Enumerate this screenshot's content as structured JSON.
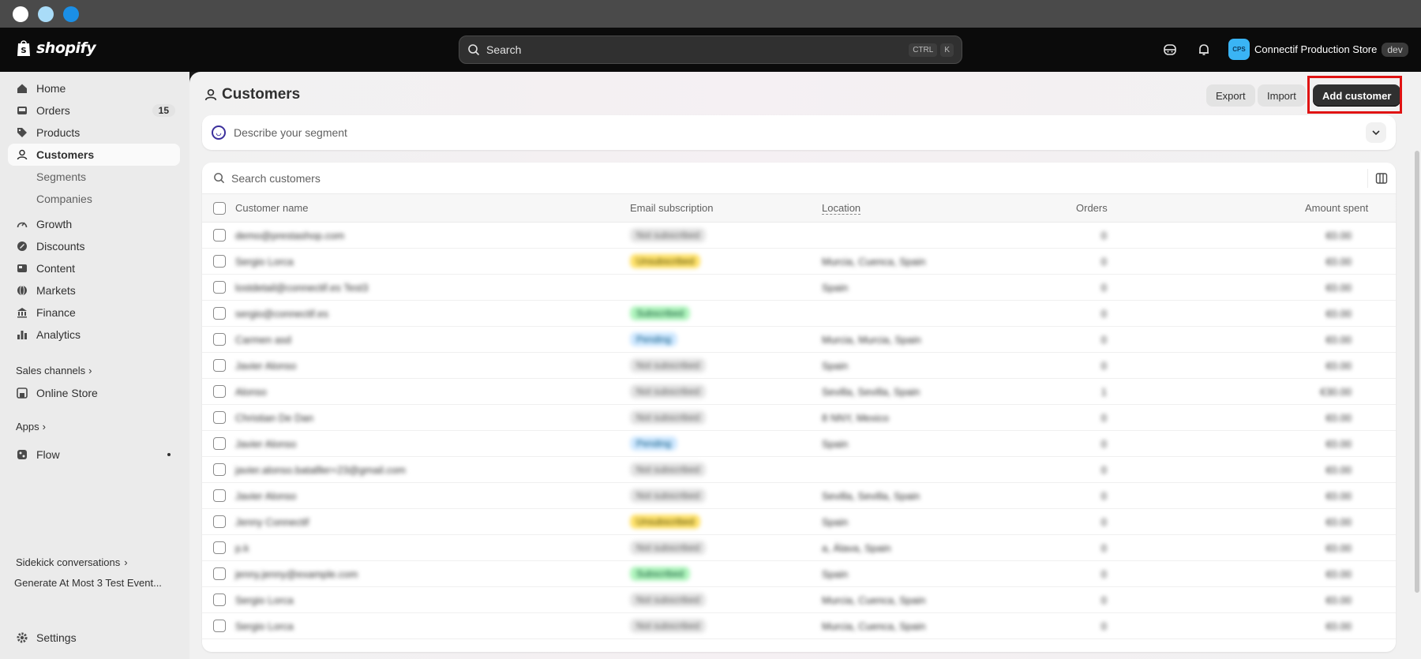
{
  "topbar": {
    "brand": "shopify",
    "search_placeholder": "Search",
    "kbd1": "CTRL",
    "kbd2": "K",
    "store_avatar": "CPS",
    "store_name": "Connectif Production Store",
    "store_tag": "dev"
  },
  "sidebar": {
    "home": "Home",
    "orders": "Orders",
    "orders_badge": "15",
    "products": "Products",
    "customers": "Customers",
    "segments": "Segments",
    "companies": "Companies",
    "growth": "Growth",
    "discounts": "Discounts",
    "content": "Content",
    "markets": "Markets",
    "finance": "Finance",
    "analytics": "Analytics",
    "sales_channels": "Sales channels",
    "online_store": "Online Store",
    "apps": "Apps",
    "flow": "Flow",
    "sidekick_title": "Sidekick conversations",
    "sidekick_item": "Generate At Most 3 Test Event...",
    "settings": "Settings"
  },
  "main": {
    "title": "Customers",
    "export": "Export",
    "import": "Import",
    "add_customer": "Add customer",
    "segment_placeholder": "Describe your segment",
    "search_placeholder": "Search customers",
    "columns": {
      "name": "Customer name",
      "email": "Email subscription",
      "location": "Location",
      "orders": "Orders",
      "amount": "Amount spent"
    },
    "rows": [
      {
        "name": "demo@prestashop.com",
        "email": "Not subscribed",
        "email_color": "gray",
        "location": "",
        "orders": "0",
        "amount": "€0.00"
      },
      {
        "name": "Sergio Lorca",
        "email": "Unsubscribed",
        "email_color": "yellow",
        "location": "Murcia, Cuenca, Spain",
        "orders": "0",
        "amount": "€0.00"
      },
      {
        "name": "lostdetail@connectif.es Test3",
        "email": "",
        "email_color": "",
        "location": "Spain",
        "orders": "0",
        "amount": "€0.00"
      },
      {
        "name": "sergio@connectif.es",
        "email": "Subscribed",
        "email_color": "green",
        "location": "",
        "orders": "0",
        "amount": "€0.00"
      },
      {
        "name": "Carmen asd",
        "email": "Pending",
        "email_color": "blue",
        "location": "Murcia, Murcia, Spain",
        "orders": "0",
        "amount": "€0.00"
      },
      {
        "name": "Javier Alonso",
        "email": "Not subscribed",
        "email_color": "gray",
        "location": "Spain",
        "orders": "0",
        "amount": "€0.00"
      },
      {
        "name": "Alonso",
        "email": "Not subscribed",
        "email_color": "gray",
        "location": "Sevilla, Sevilla, Spain",
        "orders": "1",
        "amount": "€30.00"
      },
      {
        "name": "Christian De Dan",
        "email": "Not subscribed",
        "email_color": "gray",
        "location": "8 NNY, Mexico",
        "orders": "0",
        "amount": "€0.00"
      },
      {
        "name": "Javier Alonso",
        "email": "Pending",
        "email_color": "blue",
        "location": "Spain",
        "orders": "0",
        "amount": "€0.00"
      },
      {
        "name": "javier.alonso.batalller+23@gmail.com",
        "email": "Not subscribed",
        "email_color": "gray",
        "location": "",
        "orders": "0",
        "amount": "€0.00"
      },
      {
        "name": "Javier Alonso",
        "email": "Not subscribed",
        "email_color": "gray",
        "location": "Sevilla, Sevilla, Spain",
        "orders": "0",
        "amount": "€0.00"
      },
      {
        "name": "Jenny Connectif",
        "email": "Unsubscribed",
        "email_color": "yellow",
        "location": "Spain",
        "orders": "0",
        "amount": "€0.00"
      },
      {
        "name": "p.k",
        "email": "Not subscribed",
        "email_color": "gray",
        "location": "a, Álava, Spain",
        "orders": "0",
        "amount": "€0.00"
      },
      {
        "name": "jenny.jenny@example.com",
        "email": "Subscribed",
        "email_color": "green",
        "location": "Spain",
        "orders": "0",
        "amount": "€0.00"
      },
      {
        "name": "Sergio Lorca",
        "email": "Not subscribed",
        "email_color": "gray",
        "location": "Murcia, Cuenca, Spain",
        "orders": "0",
        "amount": "€0.00"
      },
      {
        "name": "Sergio Lorca",
        "email": "Not subscribed",
        "email_color": "gray",
        "location": "Murcia, Cuenca, Spain",
        "orders": "0",
        "amount": "€0.00"
      }
    ]
  }
}
